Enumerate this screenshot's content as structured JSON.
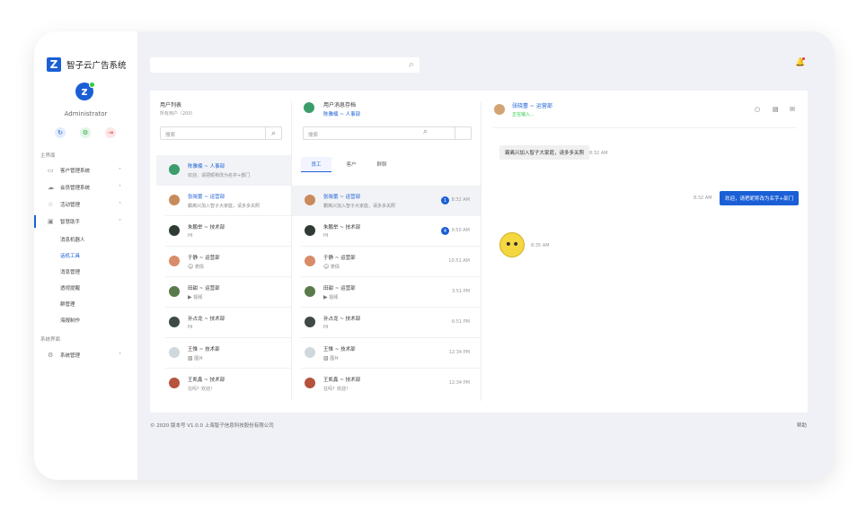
{
  "app": {
    "logo_letter": "Z",
    "title": "智子云广告系统",
    "avatar_letter": "z",
    "user": "Administrator"
  },
  "topbar": {
    "search_placeholder": ""
  },
  "sidebar": {
    "section1": "主界面",
    "items": [
      {
        "label": "客户管理系统",
        "icon": "monitor-icon"
      },
      {
        "label": "会员管理系统",
        "icon": "cloud-icon"
      },
      {
        "label": "活动管理",
        "icon": "star-icon"
      },
      {
        "label": "智慧助手",
        "icon": "robot-icon"
      }
    ],
    "sub_items": [
      "消息机器人",
      "话机工具",
      "消息管理",
      "透视提醒",
      "群管理",
      "海报制作"
    ],
    "active_sub": "话机工具",
    "section2": "系统界面",
    "system_item": "系统管理"
  },
  "user_list": {
    "title": "用户列表",
    "subtitle": "所有用户（200）",
    "search_placeholder": "搜索",
    "rows": [
      {
        "name": "陈雅楠 ~ 人事部",
        "msg": "欢迎，请把昵称改为名字+部门"
      },
      {
        "name": "张晓蕾 ~ 运营部",
        "msg": "霸离兴加入智子大家庭，请多多关照"
      },
      {
        "name": "朱鹏举 ~ 技术部",
        "msg": "HI"
      },
      {
        "name": "于静 ~ 运营部",
        "msg": "表情"
      },
      {
        "name": "田甜 ~ 运营部",
        "msg": "视频"
      },
      {
        "name": "孙占龙 ~ 技术部",
        "msg": "HI"
      },
      {
        "name": "王惟 ~ 技术部",
        "msg": "图片"
      },
      {
        "name": "王凯鑫 ~ 技术部",
        "msg": "在吗？欢迎！"
      }
    ]
  },
  "history": {
    "title": "用户消息存档",
    "current": "陈雅楠 ~ 人事部",
    "search_placeholder": "搜索",
    "tabs": [
      "员工",
      "客户",
      "群聊"
    ],
    "rows": [
      {
        "name": "张晓蕾 ~ 运营部",
        "msg": "霸离兴加入智子大家庭，请多多关照",
        "time": "8:32 AM",
        "badge": "1"
      },
      {
        "name": "朱鹏举 ~ 技术部",
        "msg": "HI",
        "time": "9:50 AM",
        "badge": "4"
      },
      {
        "name": "于静 ~ 运营部",
        "msg": "表情",
        "time": "10:51 AM",
        "badge": ""
      },
      {
        "name": "田甜 ~ 运营部",
        "msg": "视频",
        "time": "3:51 PM",
        "badge": ""
      },
      {
        "name": "孙占龙 ~ 技术部",
        "msg": "HI",
        "time": "6:51 PM",
        "badge": ""
      },
      {
        "name": "王惟 ~ 技术部",
        "msg": "图片",
        "time": "12:34 PM",
        "badge": ""
      },
      {
        "name": "王凯鑫 ~ 技术部",
        "msg": "在吗？欢迎！",
        "time": "12:34 PM",
        "badge": ""
      }
    ]
  },
  "chat": {
    "name": "张晓蕾 ~ 运营部",
    "status": "正在输入...",
    "msg1": "霸离兴加入智子大家庭，请多多关照",
    "msg1_time": "8:32 AM",
    "msg2": "欢迎，请把昵称改为名字+部门",
    "msg2_time": "8:32 AM",
    "msg3_time": "8:35 AM"
  },
  "footer": {
    "copyright": "© 2020 版本号 V1.0.0 上海智子信息科技股份有限公司",
    "help": "帮助"
  }
}
